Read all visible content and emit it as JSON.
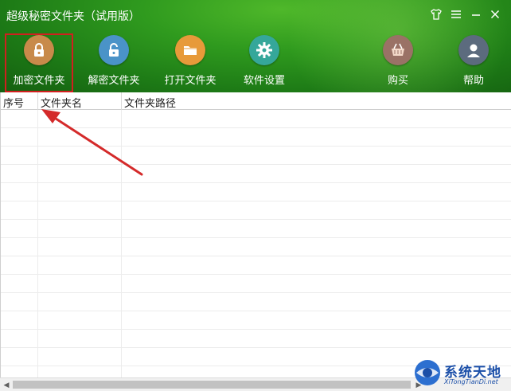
{
  "window": {
    "title": "超级秘密文件夹（试用版）",
    "controls": [
      "shirt-icon",
      "menu-icon",
      "minimize-icon",
      "close-icon"
    ]
  },
  "toolbar": {
    "items": [
      {
        "label": "加密文件夹",
        "icon": "lock-closed-icon",
        "color": "#c88a4a",
        "active": true
      },
      {
        "label": "解密文件夹",
        "icon": "lock-open-icon",
        "color": "#4a93c8"
      },
      {
        "label": "打开文件夹",
        "icon": "folder-icon",
        "color": "#e79a3a"
      },
      {
        "label": "软件设置",
        "icon": "gear-icon",
        "color": "#35a79a"
      },
      {
        "label": "购买",
        "icon": "basket-icon",
        "color": "#9a7266"
      },
      {
        "label": "帮助",
        "icon": "user-icon",
        "color": "#5c6b7e"
      }
    ]
  },
  "table": {
    "columns": [
      "序号",
      "文件夹名",
      "文件夹路径"
    ],
    "rows": []
  },
  "watermark": {
    "text": "系统天地",
    "sub": "XiTongTianDi.net"
  },
  "colors": {
    "header_green": "#2f9a1e",
    "highlight_red": "#d11f1f",
    "arrow_red": "#d42a2a"
  }
}
